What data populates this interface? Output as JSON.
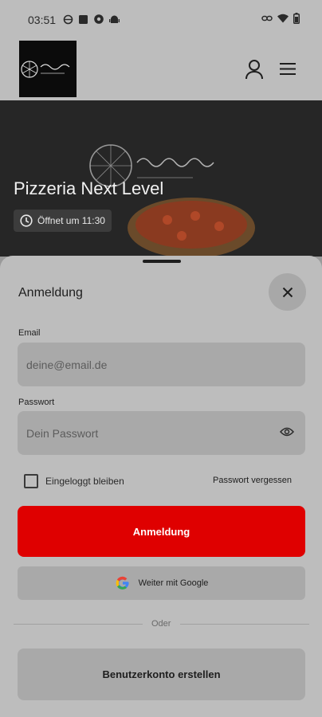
{
  "status_bar": {
    "time": "03:51",
    "left_icons": [
      "circle-icon",
      "square-icon",
      "settings-icon",
      "android-icon"
    ],
    "right_icons": [
      "link-icon",
      "wifi-icon",
      "battery-icon"
    ]
  },
  "header": {
    "logo_text": "Next Level Pizza",
    "logo_subtext": "THE ART OF PIZZA",
    "icons": [
      "user-icon",
      "menu-icon"
    ]
  },
  "hero": {
    "title": "Pizzeria Next Level",
    "opening_hours": "Öffnet um 11:30",
    "brand_overlay": "Next Level Pizza",
    "brand_overlay_sub": "THE ART OF PIZZA"
  },
  "login_sheet": {
    "title": "Anmeldung",
    "email_label": "Email",
    "email_placeholder": "deine@email.de",
    "password_label": "Passwort",
    "password_placeholder": "Dein Passwort",
    "remember_label": "Eingeloggt bleiben",
    "remember_checked": false,
    "forgot_label": "Passwort vergessen",
    "login_button": "Anmeldung",
    "google_button": "Weiter mit Google",
    "divider_text": "Oder",
    "register_button": "Benutzerkonto erstellen"
  },
  "colors": {
    "accent": "#df0000",
    "sheet_background": "#bdbdbd",
    "field_background": "#a9a9a9"
  }
}
